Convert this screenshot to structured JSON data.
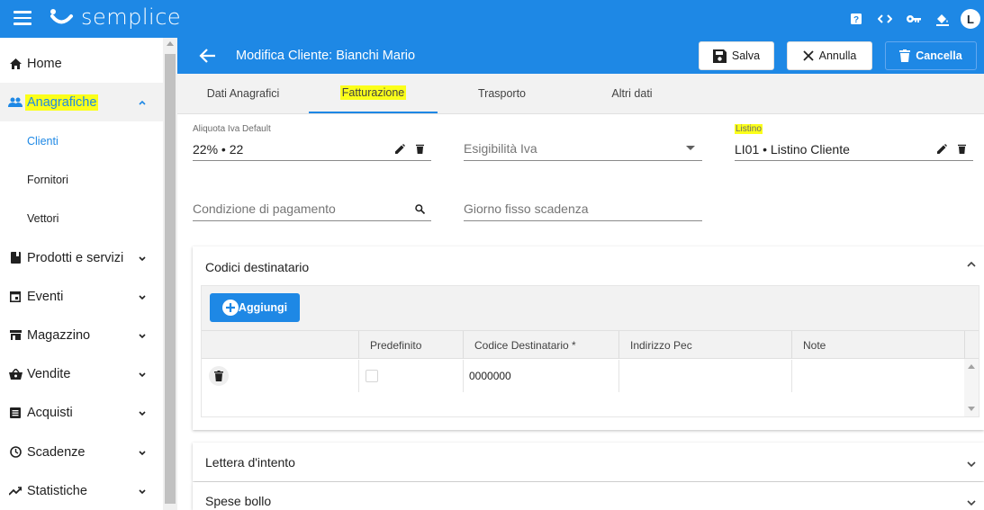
{
  "app": {
    "logo_text": "semplice",
    "avatar_initial": "L",
    "brand_color": "#1e88e5",
    "highlight_color": "#fbff1a",
    "top_icons": [
      "help-icon",
      "code-icon",
      "key-icon",
      "paint-bucket-icon"
    ]
  },
  "sidebar": {
    "items": [
      {
        "label": "Home",
        "icon": "home-icon"
      },
      {
        "label": "Anagrafiche",
        "icon": "people-icon",
        "expanded": true
      },
      {
        "label": "Prodotti e servizi",
        "icon": "book-icon"
      },
      {
        "label": "Eventi",
        "icon": "calendar-icon"
      },
      {
        "label": "Magazzino",
        "icon": "warehouse-icon"
      },
      {
        "label": "Vendite",
        "icon": "basket-icon"
      },
      {
        "label": "Acquisti",
        "icon": "list-icon"
      },
      {
        "label": "Scadenze",
        "icon": "clock-icon"
      },
      {
        "label": "Statistiche",
        "icon": "trending-icon"
      }
    ],
    "subitems": [
      {
        "label": "Clienti",
        "selected": true
      },
      {
        "label": "Fornitori"
      },
      {
        "label": "Vettori"
      }
    ]
  },
  "header": {
    "title": "Modifica Cliente: Bianchi Mario",
    "save_label": "Salva",
    "cancel_label": "Annulla",
    "delete_label": "Cancella"
  },
  "tabs": [
    {
      "label": "Dati Anagrafici"
    },
    {
      "label": "Fatturazione",
      "active": true
    },
    {
      "label": "Trasporto"
    },
    {
      "label": "Altri dati"
    }
  ],
  "form": {
    "aliquota": {
      "label": "Aliquota Iva Default",
      "value": "22% • 22"
    },
    "esigibilita": {
      "placeholder": "Esigibilità Iva"
    },
    "listino": {
      "label": "Listino",
      "value": "LI01 • Listino Cliente"
    },
    "condizione": {
      "placeholder": "Condizione di pagamento"
    },
    "giorno": {
      "placeholder": "Giorno fisso scadenza"
    }
  },
  "codici_panel": {
    "title": "Codici destinatario",
    "add_label": "Aggiungi",
    "columns": [
      "Predefinito",
      "Codice Destinatario *",
      "Indirizzo Pec",
      "Note"
    ],
    "rows": [
      {
        "predefinito": false,
        "codice": "0000000",
        "pec": "",
        "note": ""
      }
    ]
  },
  "panels": [
    {
      "title": "Lettera d'intento"
    },
    {
      "title": "Spese bollo"
    }
  ]
}
